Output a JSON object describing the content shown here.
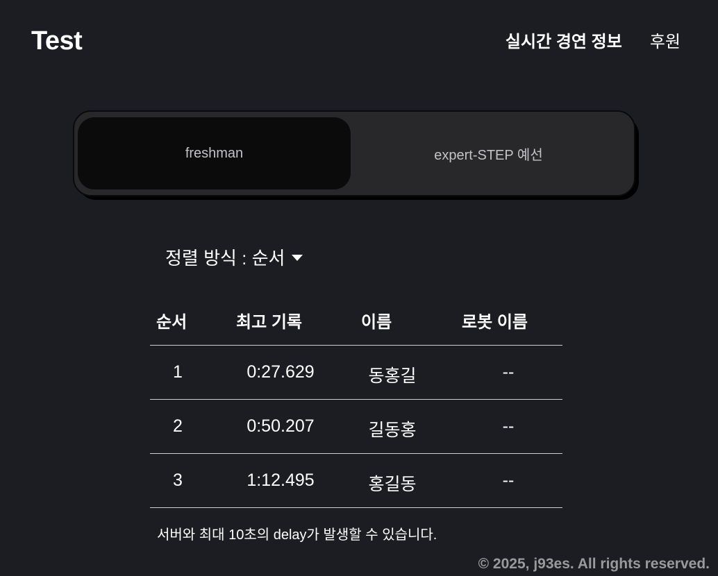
{
  "header": {
    "logo": "Test",
    "nav": [
      {
        "label": "실시간 경연 정보"
      },
      {
        "label": "후원"
      }
    ]
  },
  "tabs": [
    {
      "label": "freshman",
      "active": true
    },
    {
      "label": "expert-STEP 예선",
      "active": false
    }
  ],
  "sort": {
    "label": "정렬 방식 : 순서"
  },
  "table": {
    "columns": [
      "순서",
      "최고 기록",
      "이름",
      "로봇 이름"
    ],
    "rows": [
      [
        "1",
        "0:27.629",
        "동홍길",
        "--"
      ],
      [
        "2",
        "0:50.207",
        "길동홍",
        "--"
      ],
      [
        "3",
        "1:12.495",
        "홍길동",
        "--"
      ]
    ]
  },
  "note": "서버와 최대 10초의 delay가 발생할 수 있습니다.",
  "footer": "© 2025, j93es. All rights reserved."
}
